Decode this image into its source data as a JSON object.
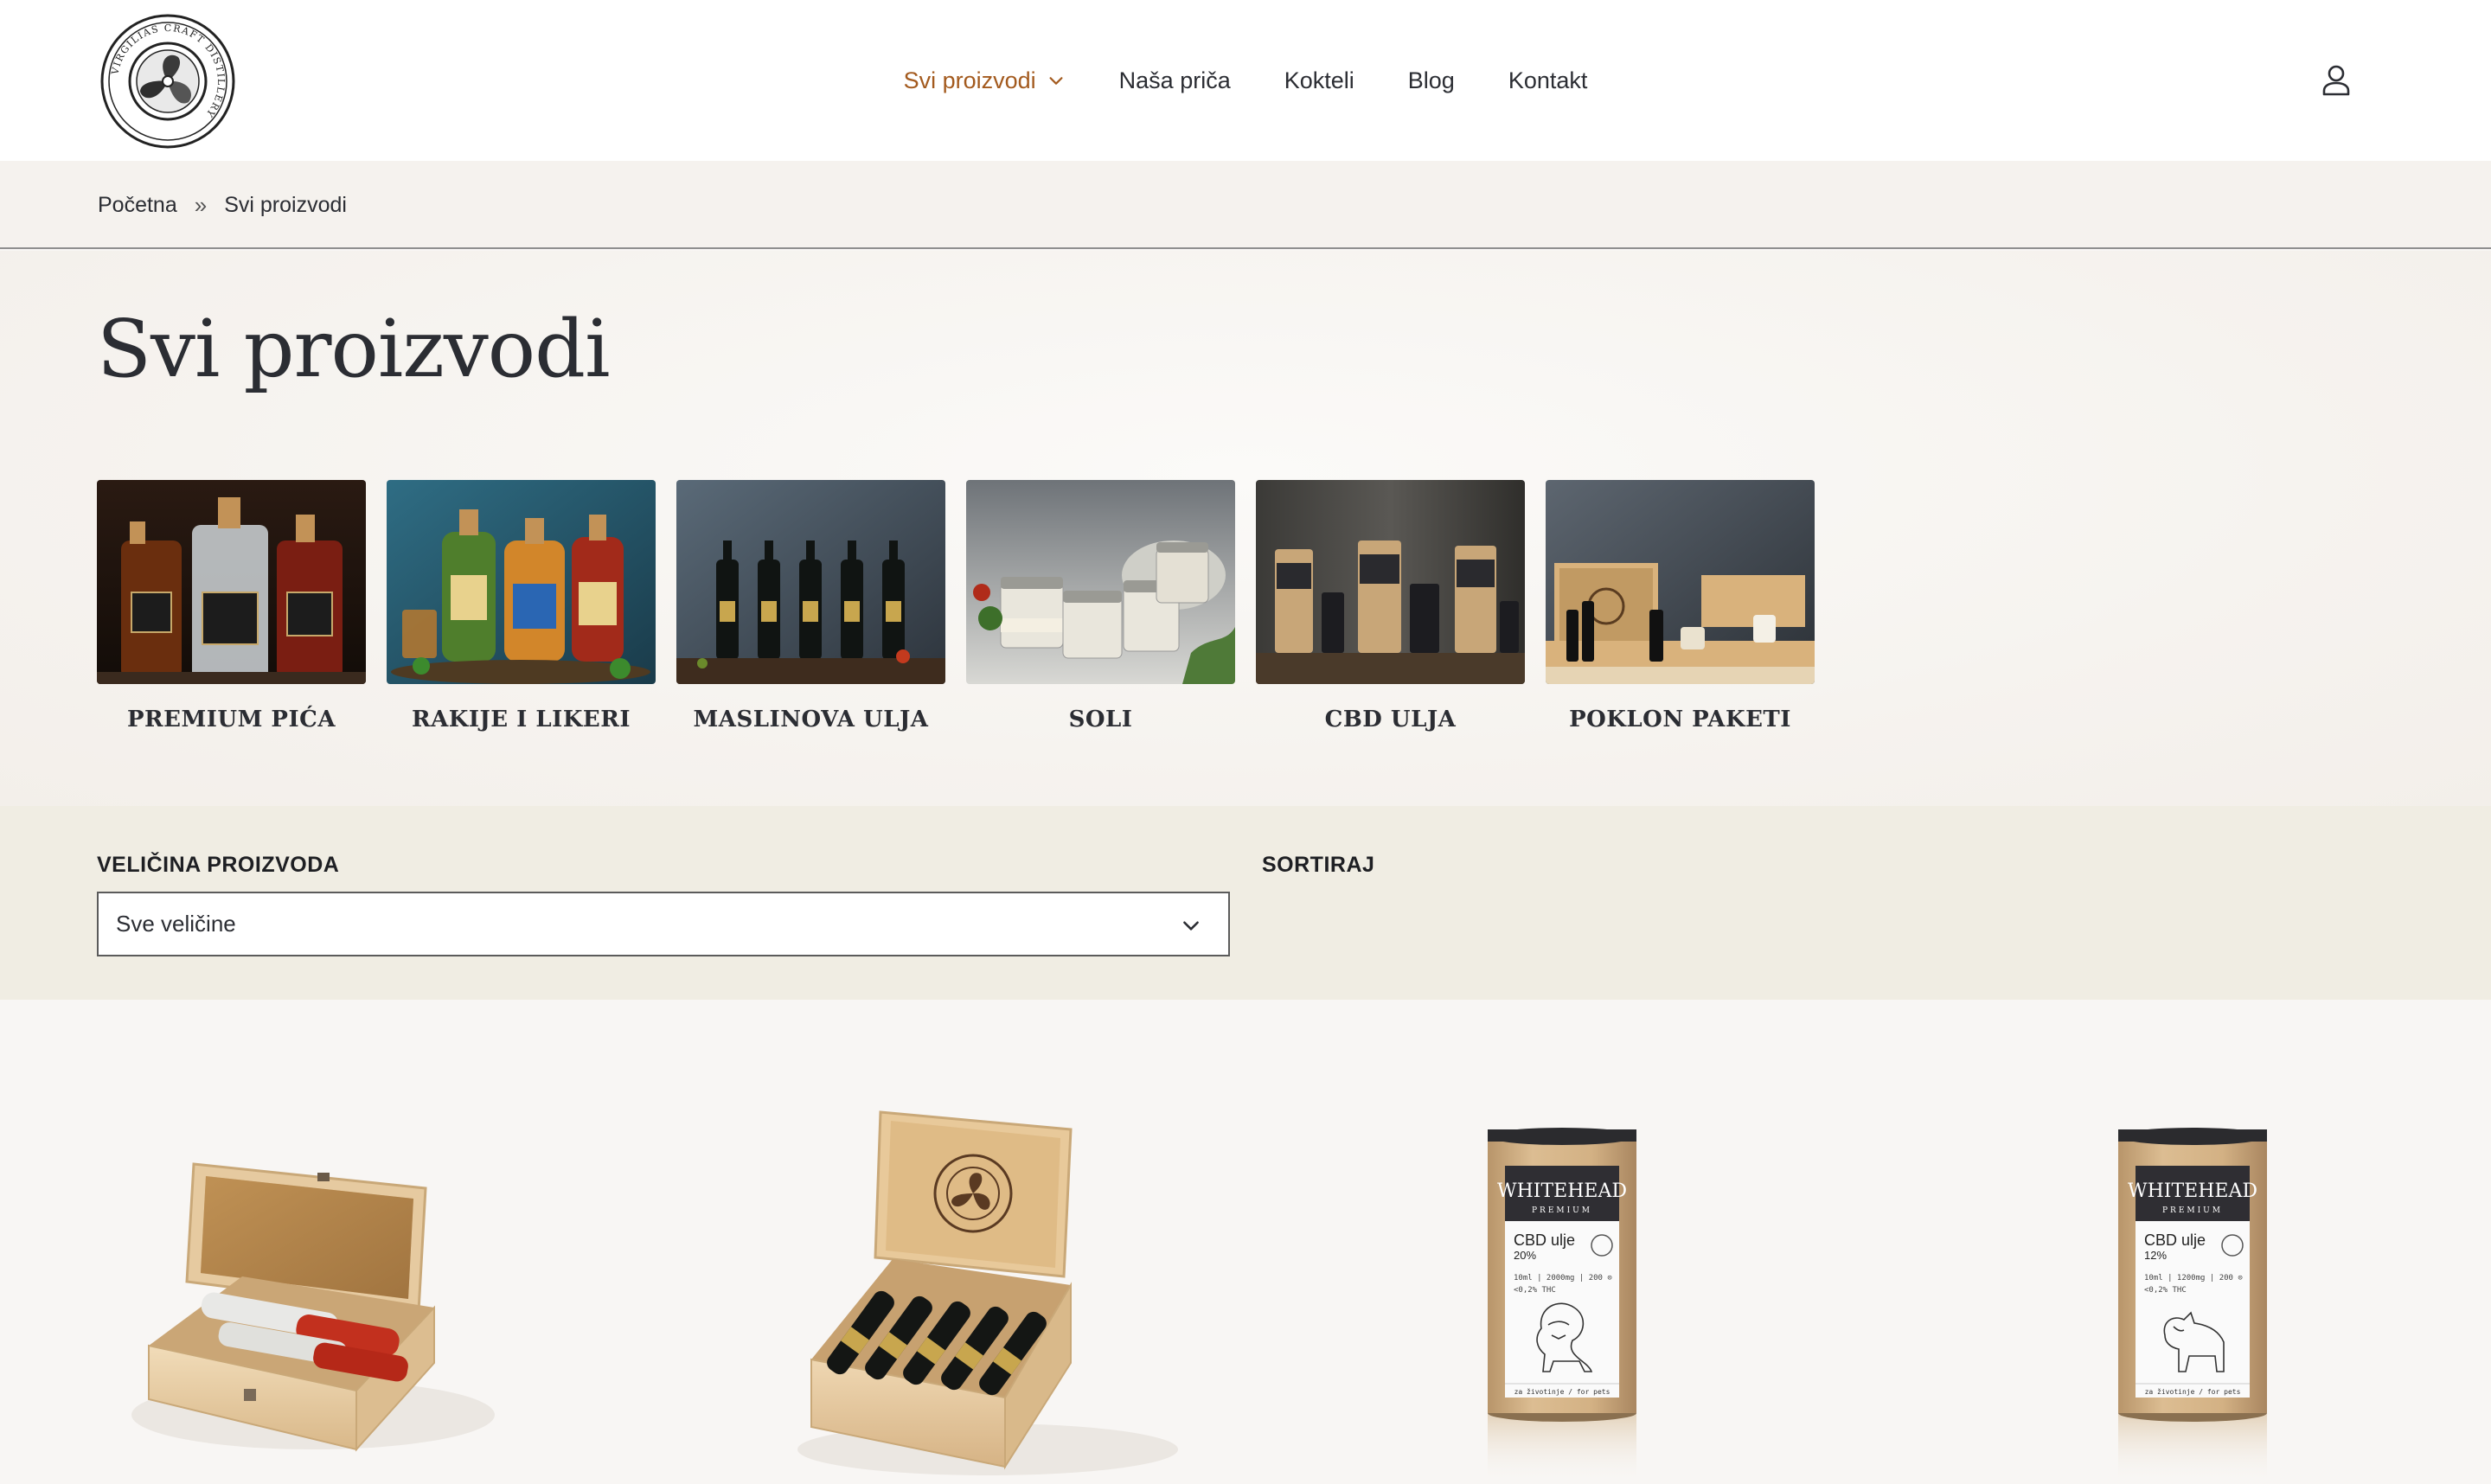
{
  "header": {
    "logo_alt": "Virgilia Craft Distillery",
    "logo_text": "VIRGILIAS CRAFT DISTILLERY",
    "nav": [
      {
        "label": "Svi proizvodi",
        "active": true,
        "has_dropdown": true
      },
      {
        "label": "Naša priča"
      },
      {
        "label": "Kokteli"
      },
      {
        "label": "Blog"
      },
      {
        "label": "Kontakt"
      }
    ],
    "user_icon": "user-icon"
  },
  "breadcrumb": {
    "home": "Početna",
    "separator": "»",
    "current": "Svi proizvodi"
  },
  "page": {
    "title": "Svi proizvodi"
  },
  "categories": [
    {
      "label": "PREMIUM PIĆA",
      "image": "premium-drinks-photo"
    },
    {
      "label": "RAKIJE I LIKERI",
      "image": "brandies-liqueurs-photo"
    },
    {
      "label": "MASLINOVA ULJA",
      "image": "olive-oils-photo"
    },
    {
      "label": "SOLI",
      "image": "salts-photo"
    },
    {
      "label": "CBD ULJA",
      "image": "cbd-oils-photo"
    },
    {
      "label": "POKLON PAKETI",
      "image": "gift-packages-photo"
    }
  ],
  "filters": {
    "size_label": "VELIČINA PROIZVODA",
    "size_value": "Sve veličine",
    "sort_label": "SORTIRAJ"
  },
  "products": [
    {
      "image": "wooden-gift-box-liqueurs"
    },
    {
      "image": "wooden-gift-box-olive-oils"
    },
    {
      "image": "cbd-oil-tube-20",
      "brand": "WHITEHEAD",
      "sub": "PREMIUM",
      "name": "CBD ulje",
      "strength": "20%",
      "spec1": "10ml | 2000mg | 200 ⊙",
      "spec2": "<0,2% THC",
      "footer": "za životinje / for pets"
    },
    {
      "image": "cbd-oil-tube-12",
      "brand": "WHITEHEAD",
      "sub": "PREMIUM",
      "name": "CBD ulje",
      "strength": "12%",
      "spec1": "10ml | 1200mg | 200 ⊙",
      "spec2": "<0,2% THC",
      "footer": "za životinje / for pets"
    }
  ],
  "colors": {
    "accent": "#a35a1e",
    "text": "#2b2d33",
    "filter_bg": "#f0ede3",
    "page_bg": "#f8f6f4"
  }
}
